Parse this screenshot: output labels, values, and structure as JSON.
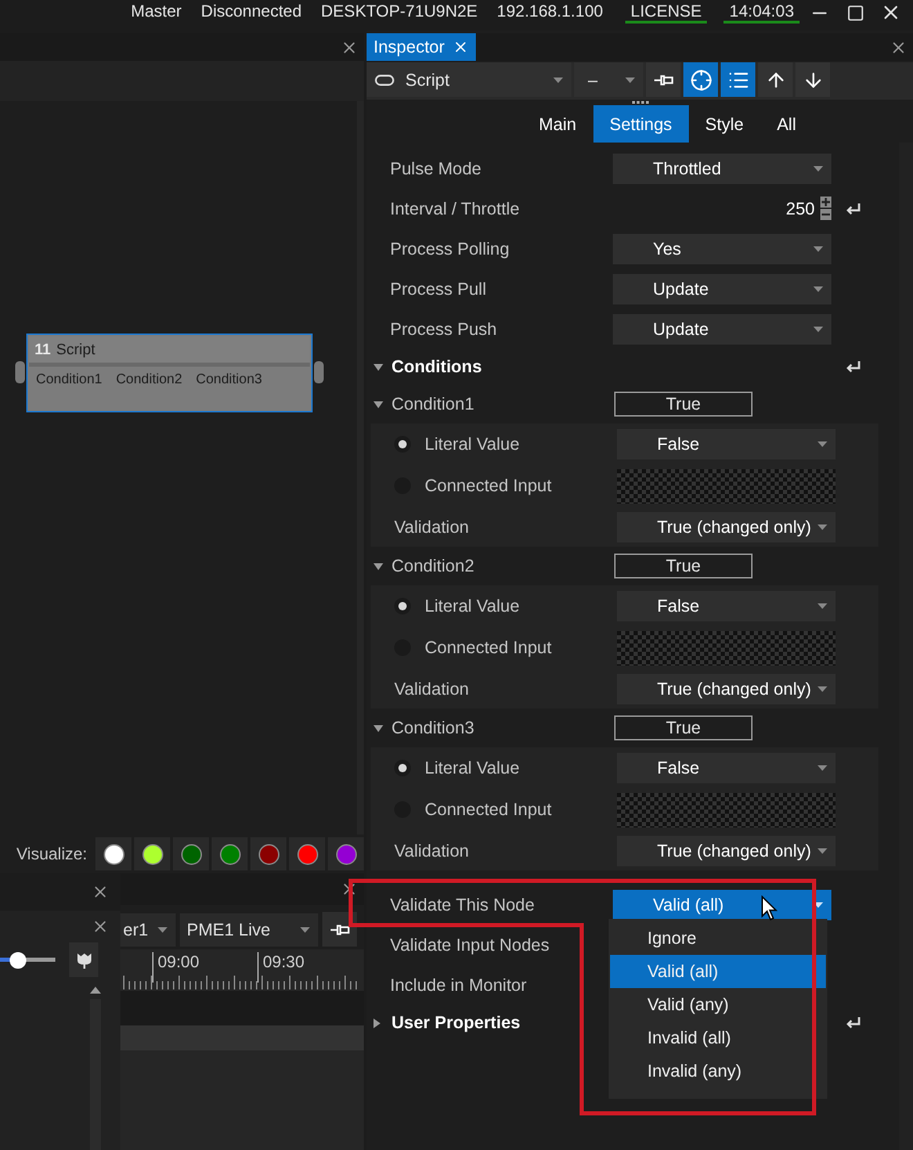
{
  "status_bar": {
    "items": [
      {
        "text": "Master",
        "underlined": false
      },
      {
        "text": "Disconnected",
        "underlined": false
      },
      {
        "text": "DESKTOP-71U9N2E",
        "underlined": false
      },
      {
        "text": "192.168.1.100",
        "underlined": false
      },
      {
        "text": "LICENSE",
        "underlined": true
      },
      {
        "text": "14:04:03",
        "underlined": true
      }
    ]
  },
  "canvas_panel": {
    "node": {
      "number": "11",
      "title": "Script",
      "outputs": [
        "Condition1",
        "Condition2",
        "Condition3"
      ]
    },
    "visualize": {
      "label": "Visualize:",
      "colors": [
        {
          "color": "#ffffff"
        },
        {
          "color": "#adff2f"
        },
        {
          "color": "#006400"
        },
        {
          "color": "#008000"
        },
        {
          "color": "#8b0000"
        },
        {
          "color": "#ff0000"
        },
        {
          "color": "#9400d3"
        }
      ]
    }
  },
  "timeline_panel": {
    "slider": {
      "level": 0.33
    },
    "dropdowns": [
      {
        "value": "er1"
      },
      {
        "value": "PME1 Live"
      }
    ],
    "ticks": [
      "09:00",
      "09:30"
    ]
  },
  "inspector": {
    "title": "Inspector",
    "selector": {
      "value": "Script"
    },
    "second_selector": {
      "value": "–"
    },
    "toolbar": [
      {
        "kind": "pin",
        "on": false
      },
      {
        "kind": "target",
        "on": true
      },
      {
        "kind": "list",
        "on": true
      },
      {
        "kind": "up",
        "on": false
      },
      {
        "kind": "down",
        "on": false
      }
    ],
    "tabs": [
      {
        "label": "Main",
        "selected": false
      },
      {
        "label": "Settings",
        "selected": true
      },
      {
        "label": "Style",
        "selected": false
      },
      {
        "label": "All",
        "selected": false
      }
    ],
    "properties": [
      {
        "kind": "dropdown",
        "label": "Pulse Mode",
        "value": "Throttled"
      },
      {
        "kind": "number",
        "label": "Interval / Throttle",
        "value": "250",
        "resettable": true
      },
      {
        "kind": "dropdown",
        "label": "Process Polling",
        "value": "Yes"
      },
      {
        "kind": "dropdown",
        "label": "Process Pull",
        "value": "Update"
      },
      {
        "kind": "dropdown",
        "label": "Process Push",
        "value": "Update"
      },
      {
        "kind": "section",
        "label": "Conditions",
        "expanded": true,
        "resettable": true,
        "children": [
          {
            "kind": "group",
            "label": "Condition1",
            "expanded": true,
            "value": "True",
            "children": [
              {
                "kind": "radio_value",
                "label": "Literal Value",
                "selected": true,
                "value": "False"
              },
              {
                "kind": "radio_input",
                "label": "Connected Input",
                "selected": false
              },
              {
                "kind": "dropdown",
                "label": "Validation",
                "value": "True (changed only)"
              }
            ]
          },
          {
            "kind": "group",
            "label": "Condition2",
            "expanded": true,
            "value": "True",
            "children": [
              {
                "kind": "radio_value",
                "label": "Literal Value",
                "selected": true,
                "value": "False"
              },
              {
                "kind": "radio_input",
                "label": "Connected Input",
                "selected": false
              },
              {
                "kind": "dropdown",
                "label": "Validation",
                "value": "True (changed only)"
              }
            ]
          },
          {
            "kind": "group",
            "label": "Condition3",
            "expanded": true,
            "value": "True",
            "children": [
              {
                "kind": "radio_value",
                "label": "Literal Value",
                "selected": true,
                "value": "False"
              },
              {
                "kind": "radio_input",
                "label": "Connected Input",
                "selected": false
              },
              {
                "kind": "dropdown",
                "label": "Validation",
                "value": "True (changed only)"
              }
            ]
          }
        ]
      },
      {
        "kind": "dropdown",
        "label": "Validate This Node",
        "value": "Valid (all)",
        "open": true,
        "highlighted": true,
        "options": [
          {
            "label": "Ignore",
            "selected": false
          },
          {
            "label": "Valid (all)",
            "selected": true
          },
          {
            "label": "Valid (any)",
            "selected": false
          },
          {
            "label": "Invalid (all)",
            "selected": false
          },
          {
            "label": "Invalid (any)",
            "selected": false
          }
        ]
      },
      {
        "kind": "plain",
        "label": "Validate Input Nodes"
      },
      {
        "kind": "plain",
        "label": "Include in Monitor"
      },
      {
        "kind": "section",
        "label": "User Properties",
        "expanded": false,
        "resettable": true
      }
    ]
  }
}
